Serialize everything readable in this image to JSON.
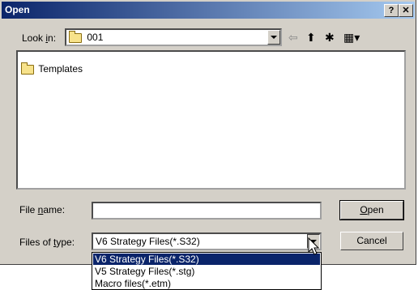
{
  "window": {
    "title": "Open",
    "help_btn": "?",
    "close_btn": "✕"
  },
  "look_in": {
    "label_pre": "Look ",
    "label_key": "i",
    "label_post": "n:",
    "value": "001"
  },
  "toolbar": {
    "back_icon": "⇦",
    "up_icon": "⬆",
    "new_folder_icon": "✱",
    "view_icon": "▦▾"
  },
  "file_list": [
    {
      "name": "Templates",
      "icon": "folder-icon"
    }
  ],
  "file_name": {
    "label_pre": "File ",
    "label_key": "n",
    "label_post": "ame:",
    "value": ""
  },
  "file_type": {
    "label_pre": "Files of ",
    "label_key": "t",
    "label_post": "ype:",
    "value": "V6 Strategy Files(*.S32)",
    "options": [
      "V6 Strategy Files(*.S32)",
      "V5 Strategy Files(*.stg)",
      "Macro files(*.etm)"
    ]
  },
  "buttons": {
    "open_key": "O",
    "open_rest": "pen",
    "cancel": "Cancel"
  }
}
